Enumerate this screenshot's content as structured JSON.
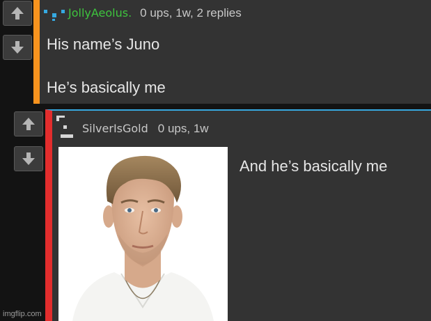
{
  "colors": {
    "page_bg": "#131313",
    "comment_bg": "#333333",
    "orange_accent": "#f7931e",
    "red_accent": "#e32d2d",
    "blue_accent": "#36a9e1",
    "green_username": "#3ec43e",
    "text": "#e6e6e6"
  },
  "comment1": {
    "username": "JollyAeolus.",
    "stats": "0 ups, 1w, 2 replies",
    "lines": [
      "His name’s Juno",
      "He’s basically me"
    ],
    "avatar_icon": "pixel-avatar-icon",
    "upvote_icon": "arrow-up-icon",
    "downvote_icon": "arrow-down-icon"
  },
  "comment2": {
    "username": "SilverIsGold",
    "stats": "0 ups, 1w",
    "text": "And he’s basically me",
    "avatar_icon": "pixel-avatar-icon",
    "upvote_icon": "arrow-up-icon",
    "downvote_icon": "arrow-down-icon",
    "image_icon": "portrait-photo"
  },
  "watermark": "imgflip.com"
}
